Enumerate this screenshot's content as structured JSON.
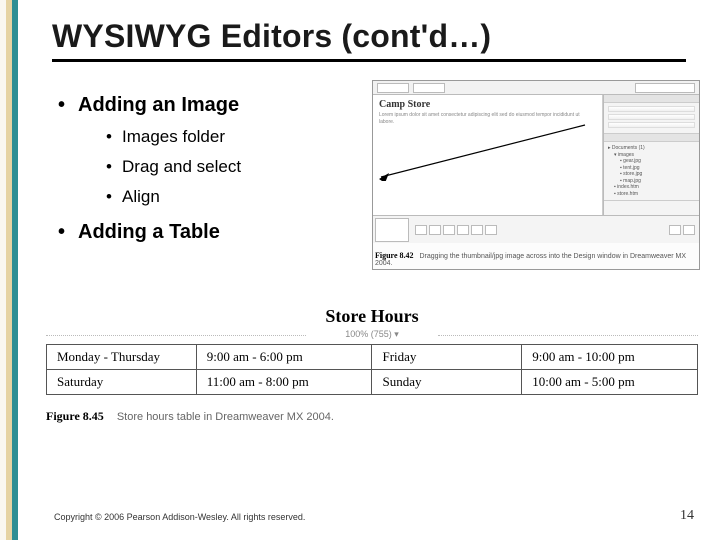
{
  "title": "WYSIWYG Editors (cont'd…)",
  "bullets": {
    "b1": "Adding an Image",
    "b1_sub": {
      "a": "Images folder",
      "b": "Drag and select",
      "c": "Align"
    },
    "b2": "Adding a Table"
  },
  "fig_top": {
    "doc_title": "Camp Store",
    "doc_text": "Lorem ipsum dolor sit amet consectetur adipiscing elit sed do eiusmod tempor incididunt ut labore.",
    "caption_num": "Figure 8.42",
    "caption_text": "Dragging the thumbnail/jpg image across into the Design window in Dreamweaver MX 2004."
  },
  "store": {
    "heading": "Store Hours",
    "sub": "100% (755) ▾",
    "rows": [
      {
        "d1": "Monday - Thursday",
        "t1": "9:00 am - 6:00 pm",
        "d2": "Friday",
        "t2": "9:00 am - 10:00 pm"
      },
      {
        "d1": "Saturday",
        "t1": "11:00 am - 8:00 pm",
        "d2": "Sunday",
        "t2": "10:00 am - 5:00 pm"
      }
    ]
  },
  "fig_table": {
    "num": "Figure 8.45",
    "text": "Store hours table in Dreamweaver MX 2004."
  },
  "footer": "Copyright © 2006 Pearson Addison-Wesley. All rights reserved.",
  "page": "14"
}
